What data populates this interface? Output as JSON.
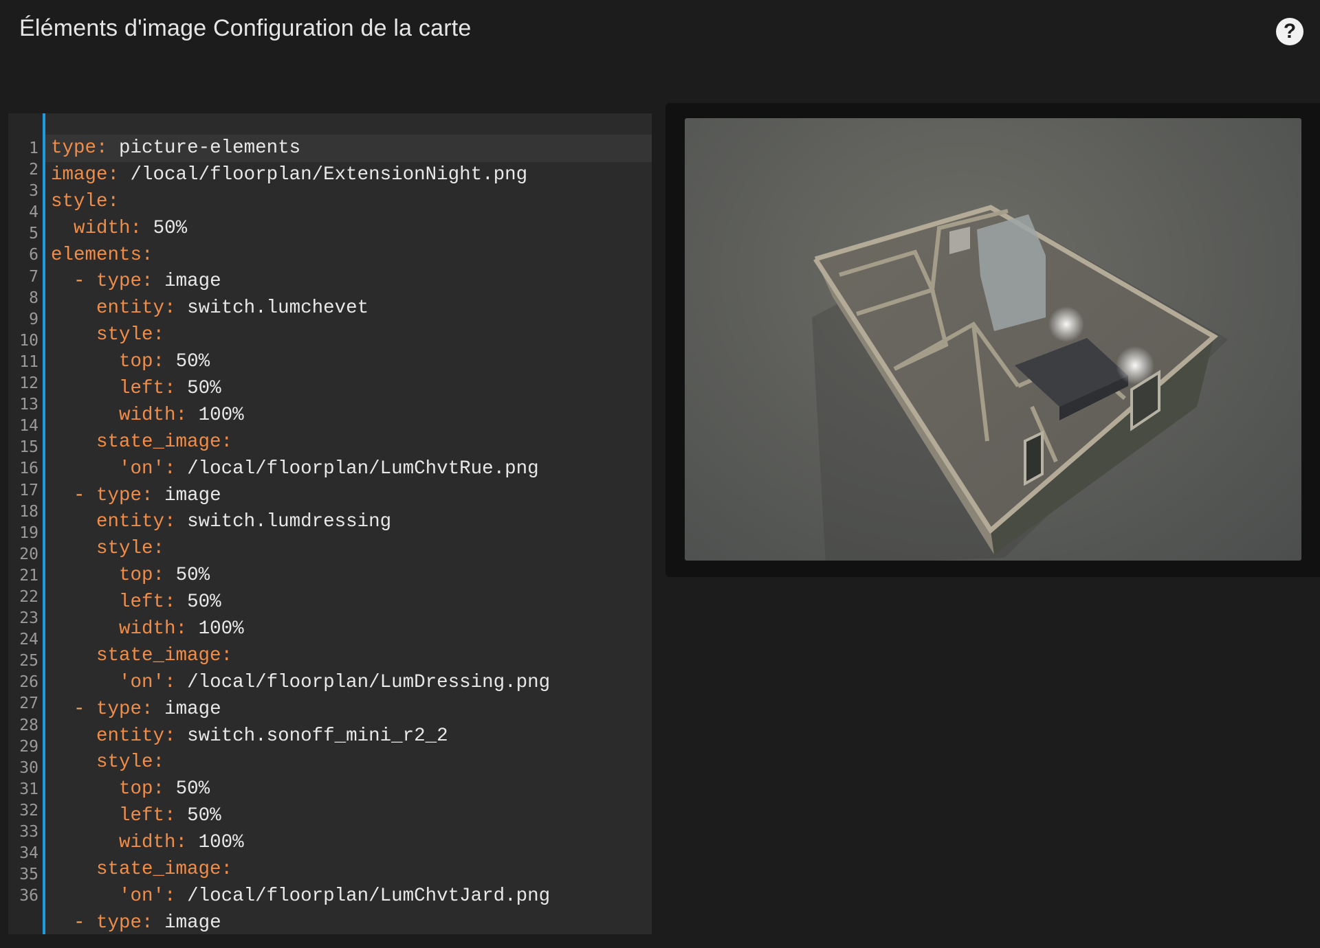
{
  "header": {
    "title": "Éléments d'image Configuration de la carte",
    "help_icon": "?"
  },
  "editor": {
    "line_numbers": [
      "1",
      "2",
      "3",
      "4",
      "5",
      "6",
      "7",
      "8",
      "9",
      "10",
      "11",
      "12",
      "13",
      "14",
      "15",
      "16",
      "17",
      "18",
      "19",
      "20",
      "21",
      "22",
      "23",
      "24",
      "25",
      "26",
      "27",
      "28",
      "29",
      "30",
      "31",
      "32",
      "33",
      "34",
      "35",
      "36"
    ],
    "lines": [
      {
        "indent": "",
        "dash": "",
        "key": "type",
        "value": "picture-elements"
      },
      {
        "indent": "",
        "dash": "",
        "key": "image",
        "value": "/local/floorplan/ExtensionNight.png"
      },
      {
        "indent": "",
        "dash": "",
        "key": "style",
        "value": ""
      },
      {
        "indent": "  ",
        "dash": "",
        "key": "width",
        "value": "50%"
      },
      {
        "indent": "",
        "dash": "",
        "key": "elements",
        "value": ""
      },
      {
        "indent": "  ",
        "dash": "- ",
        "key": "type",
        "value": "image"
      },
      {
        "indent": "    ",
        "dash": "",
        "key": "entity",
        "value": "switch.lumchevet"
      },
      {
        "indent": "    ",
        "dash": "",
        "key": "style",
        "value": ""
      },
      {
        "indent": "      ",
        "dash": "",
        "key": "top",
        "value": "50%"
      },
      {
        "indent": "      ",
        "dash": "",
        "key": "left",
        "value": "50%"
      },
      {
        "indent": "      ",
        "dash": "",
        "key": "width",
        "value": "100%"
      },
      {
        "indent": "    ",
        "dash": "",
        "key": "state_image",
        "value": ""
      },
      {
        "indent": "      ",
        "dash": "",
        "key": "'on'",
        "value": "/local/floorplan/LumChvtRue.png"
      },
      {
        "indent": "  ",
        "dash": "- ",
        "key": "type",
        "value": "image"
      },
      {
        "indent": "    ",
        "dash": "",
        "key": "entity",
        "value": "switch.lumdressing"
      },
      {
        "indent": "    ",
        "dash": "",
        "key": "style",
        "value": ""
      },
      {
        "indent": "      ",
        "dash": "",
        "key": "top",
        "value": "50%"
      },
      {
        "indent": "      ",
        "dash": "",
        "key": "left",
        "value": "50%"
      },
      {
        "indent": "      ",
        "dash": "",
        "key": "width",
        "value": "100%"
      },
      {
        "indent": "    ",
        "dash": "",
        "key": "state_image",
        "value": ""
      },
      {
        "indent": "      ",
        "dash": "",
        "key": "'on'",
        "value": "/local/floorplan/LumDressing.png"
      },
      {
        "indent": "  ",
        "dash": "- ",
        "key": "type",
        "value": "image"
      },
      {
        "indent": "    ",
        "dash": "",
        "key": "entity",
        "value": "switch.sonoff_mini_r2_2"
      },
      {
        "indent": "    ",
        "dash": "",
        "key": "style",
        "value": ""
      },
      {
        "indent": "      ",
        "dash": "",
        "key": "top",
        "value": "50%"
      },
      {
        "indent": "      ",
        "dash": "",
        "key": "left",
        "value": "50%"
      },
      {
        "indent": "      ",
        "dash": "",
        "key": "width",
        "value": "100%"
      },
      {
        "indent": "    ",
        "dash": "",
        "key": "state_image",
        "value": ""
      },
      {
        "indent": "      ",
        "dash": "",
        "key": "'on'",
        "value": "/local/floorplan/LumChvtJard.png"
      },
      {
        "indent": "  ",
        "dash": "- ",
        "key": "type",
        "value": "image"
      }
    ]
  },
  "preview": {
    "icon": "floorplan-3d-render-image"
  },
  "colors": {
    "accent": "#1e9ae0",
    "yaml_key": "#f08d49",
    "background": "#1c1c1c"
  }
}
